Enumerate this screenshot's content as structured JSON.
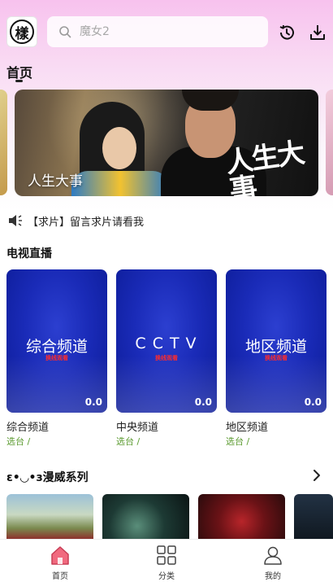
{
  "header": {
    "logo_text": "樣",
    "search": {
      "placeholder": "魔女2"
    },
    "icons": [
      "history-icon",
      "download-icon"
    ]
  },
  "main_tab": {
    "label": "首页"
  },
  "banner": {
    "caption": "人生大事",
    "logo_text": "人生大事"
  },
  "notice": {
    "text": "【求片】留言求片请看我",
    "icon": "speaker-icon"
  },
  "live_section": {
    "title": "电视直播",
    "cards": [
      {
        "big_text": "综合频道",
        "tag": "换线观看",
        "score": "0.0",
        "name": "综合频道",
        "sub": "选台 /"
      },
      {
        "big_text": "CCTV",
        "tag": "换线观看",
        "score": "0.0",
        "name": "中央频道",
        "sub": "选台 /"
      },
      {
        "big_text": "地区频道",
        "tag": "换线观看",
        "score": "0.0",
        "name": "地区频道",
        "sub": "选台 /"
      }
    ]
  },
  "marvel_section": {
    "title": "ε•◡•з漫威系列",
    "arrow_icon": "chevron-right-icon"
  },
  "tabbar": {
    "items": [
      {
        "label": "首页",
        "icon": "home-icon",
        "active": true
      },
      {
        "label": "分类",
        "icon": "grid-icon",
        "active": false
      },
      {
        "label": "我的",
        "icon": "user-icon",
        "active": false
      }
    ]
  },
  "colors": {
    "accent": "#e5566f",
    "live_card": "#1a2bb8",
    "sub_green": "#5a9a2e"
  }
}
